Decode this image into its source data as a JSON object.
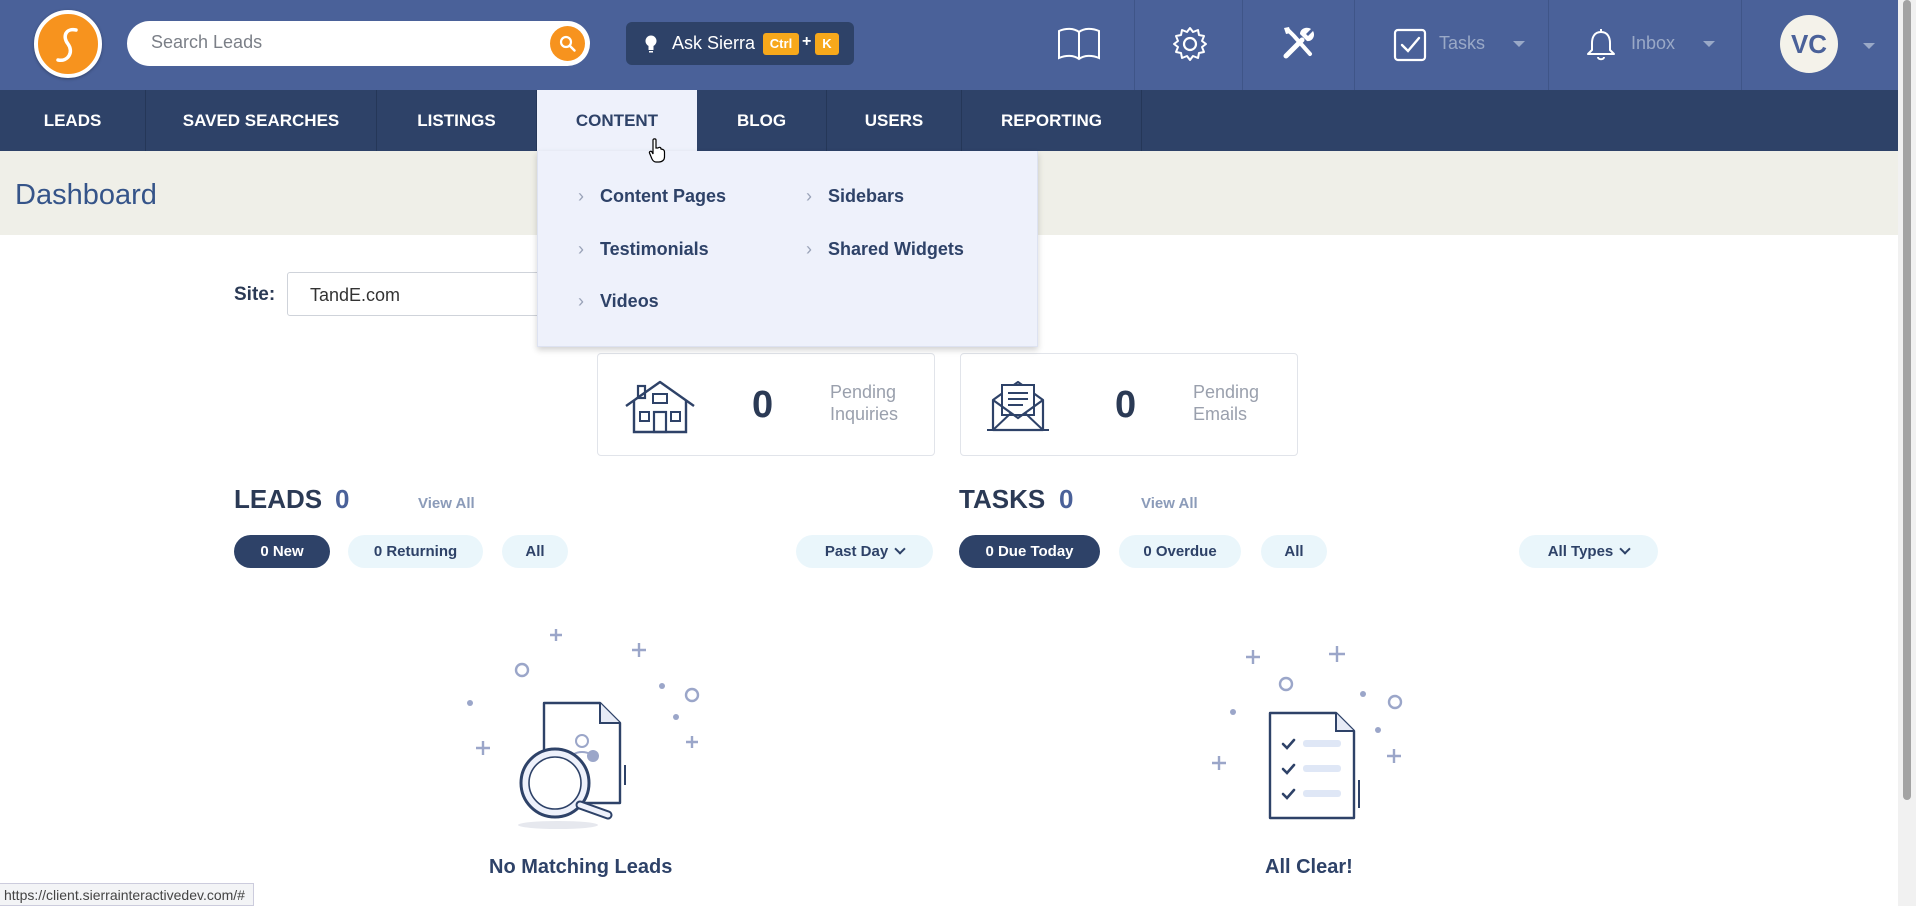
{
  "header": {
    "search_placeholder": "Search Leads",
    "ask_label": "Ask Sierra",
    "shortcut_ctrl": "Ctrl",
    "shortcut_plus": "+",
    "shortcut_key": "K",
    "tasks_label": "Tasks",
    "inbox_label": "Inbox",
    "avatar_initials": "VC"
  },
  "nav": {
    "items": [
      {
        "label": "LEADS"
      },
      {
        "label": "SAVED SEARCHES"
      },
      {
        "label": "LISTINGS"
      },
      {
        "label": "CONTENT"
      },
      {
        "label": "BLOG"
      },
      {
        "label": "USERS"
      },
      {
        "label": "REPORTING"
      }
    ],
    "active": "CONTENT"
  },
  "content_menu": {
    "items": [
      {
        "label": "Content Pages"
      },
      {
        "label": "Sidebars"
      },
      {
        "label": "Testimonials"
      },
      {
        "label": "Shared Widgets"
      },
      {
        "label": "Videos"
      }
    ]
  },
  "page": {
    "title": "Dashboard",
    "site_label": "Site:",
    "site_value": "TandE.com"
  },
  "stats": [
    {
      "value": "0",
      "caption": "Pending Inquiries",
      "icon": "house-icon"
    },
    {
      "value": "0",
      "caption": "Pending Emails",
      "icon": "envelope-icon"
    }
  ],
  "leads": {
    "title": "LEADS",
    "count": "0",
    "view_all": "View All",
    "filters": [
      "0 New",
      "0 Returning",
      "All"
    ],
    "period": "Past Day",
    "empty_text": "No Matching Leads"
  },
  "tasks": {
    "title": "TASKS",
    "count": "0",
    "view_all": "View All",
    "filters": [
      "0 Due Today",
      "0 Overdue",
      "All"
    ],
    "type": "All Types",
    "empty_text": "All Clear!"
  },
  "status_bar": {
    "url": "https://client.sierrainteractivedev.com/#"
  },
  "colors": {
    "header_blue": "#4a6199",
    "nav_dark": "#2e4268",
    "accent_orange": "#f7931e",
    "band_bg": "#efefe8"
  }
}
